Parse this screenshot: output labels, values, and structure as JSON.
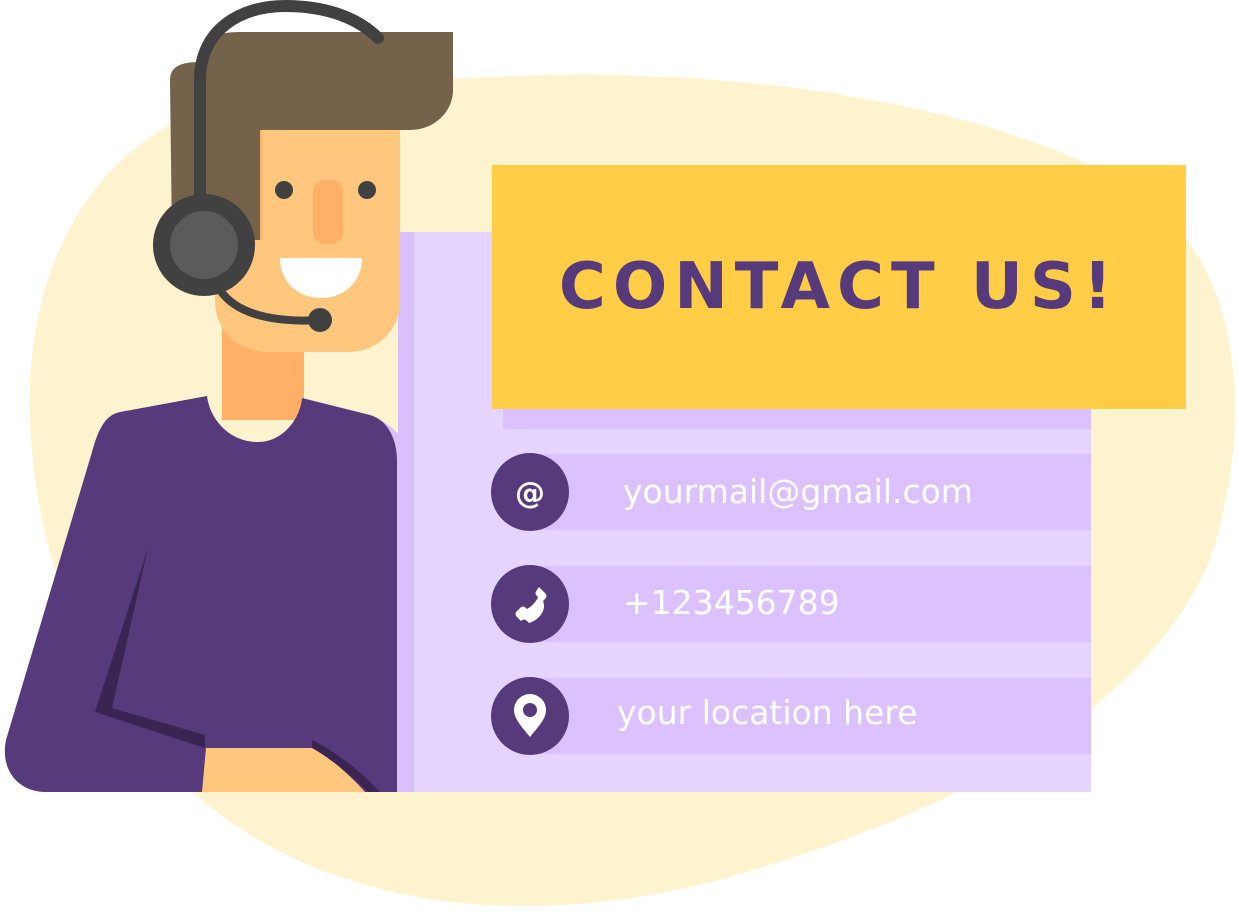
{
  "card": {
    "title": "CONTACT US!"
  },
  "contacts": [
    {
      "type": "email",
      "icon": "at-sign-icon",
      "text": "yourmail@gmail.com"
    },
    {
      "type": "phone",
      "icon": "phone-icon",
      "text": "+123456789"
    },
    {
      "type": "location",
      "icon": "map-pin-icon",
      "text": "your location here"
    }
  ],
  "colors": {
    "background_blob": "#fdf4cf",
    "banner": "#ffce46",
    "title_text": "#573a7b",
    "panel": "#e5d4ff",
    "row": "#dbc2ff",
    "icon_circle": "#573a7b",
    "shirt": "#573a7b",
    "hair": "#75624a",
    "skin": "#ffc77e",
    "headset": "#414141"
  }
}
